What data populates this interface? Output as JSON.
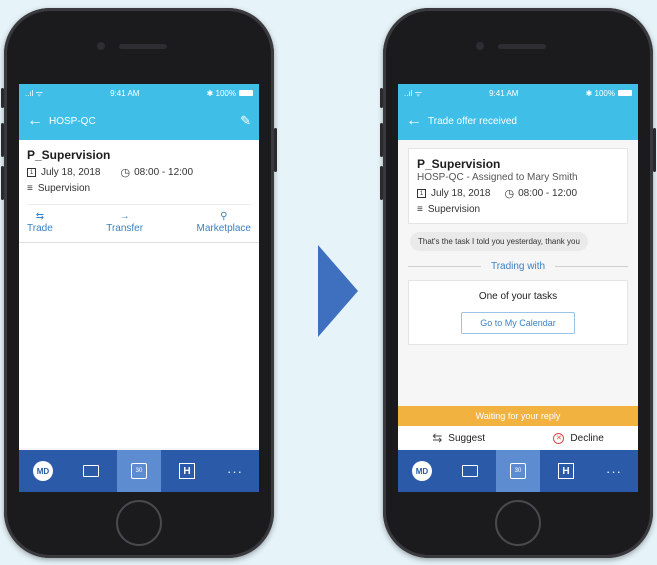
{
  "left_screen": {
    "statusbar": {
      "signal": "..ıl ᯤ",
      "time": "9:41 AM",
      "battery": "✱ 100%"
    },
    "appbar": {
      "back_icon": "arrow-left",
      "title": "HOSP-QC",
      "edit_icon": "pencil"
    },
    "task": {
      "title": "P_Supervision",
      "date": "July 18, 2018",
      "time": "08:00 - 12:00",
      "category": "Supervision"
    },
    "actions": [
      {
        "label": "Trade",
        "icon": "⇆"
      },
      {
        "label": "Transfer",
        "icon": "→"
      },
      {
        "label": "Marketplace",
        "icon": "⚲"
      }
    ]
  },
  "right_screen": {
    "statusbar": {
      "signal": "..ıl ᯤ",
      "time": "9:41 AM",
      "battery": "✱ 100%"
    },
    "appbar": {
      "back_icon": "arrow-left",
      "title": "Trade offer received"
    },
    "task": {
      "title": "P_Supervision",
      "subtitle": "HOSP-QC - Assigned to Mary Smith",
      "date": "July 18, 2018",
      "time": "08:00 - 12:00",
      "category": "Supervision"
    },
    "message": "That's the task I told you yesterday, thank you",
    "trading_with_label": "Trading with",
    "task_box": {
      "text": "One of your tasks",
      "button": "Go to My Calendar"
    },
    "waiting_banner": "Waiting for your reply",
    "suggest_label": "Suggest",
    "decline_label": "Decline"
  },
  "tabbar": {
    "md_badge": "MD",
    "calendar_day": "30",
    "h_label": "H",
    "more": "···"
  },
  "colors": {
    "header": "#3fbfe7",
    "tabbar": "#2a5aa8",
    "tab_active": "#5e8cd1",
    "accent_text": "#3b82c4",
    "waiting": "#f2b240",
    "decline": "#e04848",
    "arrow": "#3f6fbf",
    "background": "#e6f4fa"
  }
}
